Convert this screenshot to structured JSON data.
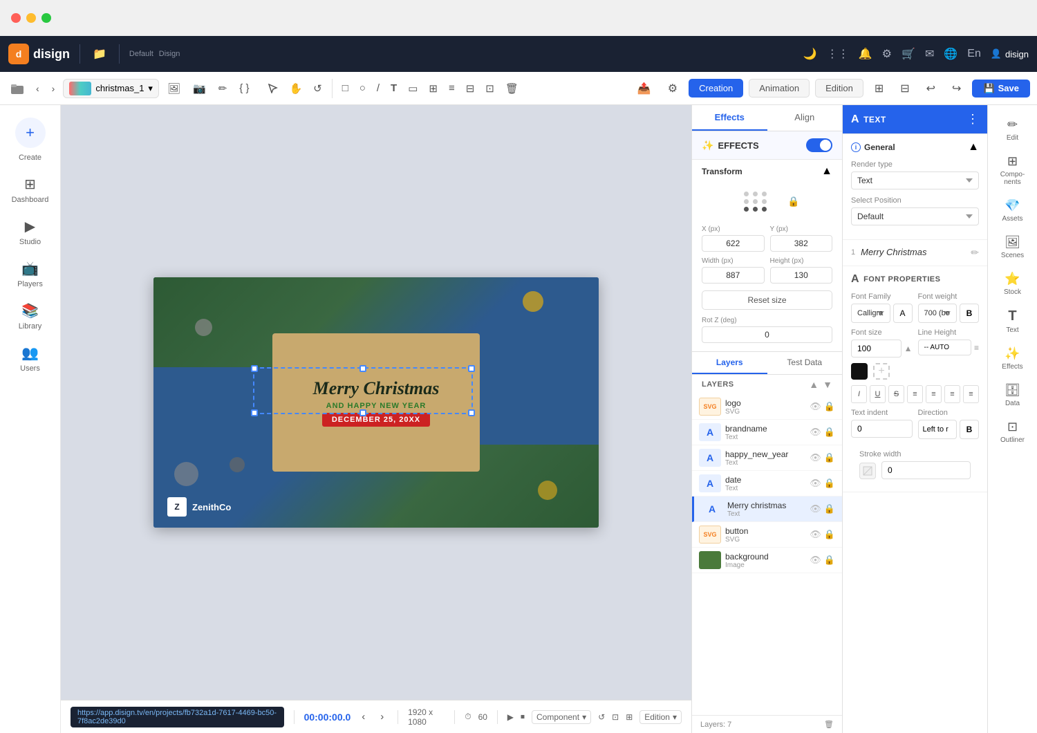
{
  "window": {
    "mac_close": "close",
    "mac_min": "minimize",
    "mac_max": "maximize"
  },
  "topnav": {
    "logo_text": "disign",
    "logo_letter": "d",
    "folder_icon": "📁",
    "breadcrumb_sep": ">",
    "project_name": "Default",
    "project_sub": "Disign",
    "right_icons": [
      "🌙",
      "⋮⋮⋮",
      "✉",
      "🔧",
      "🛒",
      "✉",
      "🌐"
    ],
    "language": "En",
    "user_icon": "👤",
    "username": "disign"
  },
  "toolbar": {
    "folder_btn": "📁",
    "nav_back": "<",
    "nav_fwd": ">",
    "filename": "christmas_1",
    "file_dropdown": "▾",
    "tool_icons": [
      "□",
      "○",
      "/",
      "T",
      "▭",
      "⊞",
      "≡",
      "⊟",
      "⊡",
      "🗑"
    ],
    "save_btn": "Save",
    "save_icon": "💾",
    "mode_creation": "Creation",
    "mode_animation": "Animation",
    "mode_edition": "Edition",
    "undo": "↩",
    "redo": "↪",
    "share_icon": "📤",
    "settings_icon": "⚙"
  },
  "left_sidebar": {
    "create_icon": "+",
    "items": [
      {
        "id": "create",
        "icon": "+",
        "label": "Create"
      },
      {
        "id": "dashboard",
        "icon": "⊞",
        "label": "Dashboard"
      },
      {
        "id": "studio",
        "icon": "▶",
        "label": "Studio"
      },
      {
        "id": "players",
        "icon": "📺",
        "label": "Players"
      },
      {
        "id": "library",
        "icon": "📚",
        "label": "Library"
      },
      {
        "id": "users",
        "icon": "👥",
        "label": "Users"
      }
    ]
  },
  "canvas": {
    "card_title": "Merry Christmas",
    "card_subtitle": "AND HAPPY NEW YEAR",
    "card_date": "DECEMBER 25, 20XX",
    "brand_letter": "Z",
    "brand_name": "ZenithCo"
  },
  "bottom_bar": {
    "url": "https://app.disign.tv/en/projects/fb732a1d-7617-4469-bc50-7f8ac2de39d0",
    "timecode": "00:00:00.0",
    "prev_icon": "<",
    "next_icon": ">",
    "dimensions": "1920 x 1080",
    "duration": "60",
    "component": "Component",
    "edition": "Edition",
    "layers_count": "Layers: 7"
  },
  "effects_panel": {
    "tab_effects": "Effects",
    "tab_align": "Align",
    "section_title": "EFFECTS",
    "toggle_on": true,
    "transform_label": "Transform",
    "x_label": "X (px)",
    "x_val": "622",
    "y_label": "Y (px)",
    "y_val": "382",
    "width_label": "Width (px)",
    "width_val": "887",
    "height_label": "Height (px)",
    "height_val": "130",
    "reset_btn": "Reset size",
    "rot_label": "Rot Z (deg)",
    "rot_val": "0"
  },
  "layers_panel": {
    "tab_layers": "Layers",
    "tab_testdata": "Test Data",
    "header": "LAYERS",
    "items": [
      {
        "id": "logo",
        "thumb_type": "svg",
        "thumb_text": "SVG",
        "name": "logo",
        "type": "SVG"
      },
      {
        "id": "brandname",
        "thumb_type": "text",
        "thumb_text": "A",
        "name": "brandname",
        "type": "Text"
      },
      {
        "id": "happy_new_year",
        "thumb_type": "text",
        "thumb_text": "A",
        "name": "happy_new_year",
        "type": "Text"
      },
      {
        "id": "date",
        "thumb_type": "text",
        "thumb_text": "A",
        "name": "date",
        "type": "Text"
      },
      {
        "id": "merry_christmas",
        "thumb_type": "text",
        "thumb_text": "A",
        "name": "Merry christmas",
        "type": "Text",
        "active": true
      },
      {
        "id": "button",
        "thumb_type": "svg",
        "thumb_text": "SVG",
        "name": "button",
        "type": "SVG"
      },
      {
        "id": "background",
        "thumb_type": "img",
        "thumb_text": "",
        "name": "background",
        "type": "Image"
      }
    ]
  },
  "props_panel": {
    "title": "TEXT",
    "title_icon": "A",
    "section_general": "General",
    "render_type_label": "Render type",
    "render_type_val": "Text",
    "select_pos_label": "Select Position",
    "select_pos_val": "Default",
    "text_line_num": "1",
    "text_line_val": "Merry Christmas",
    "font_section_title": "FONT PROPERTIES",
    "font_family_label": "Font Family",
    "font_family_val": "Calligra",
    "font_weight_label": "Font weight",
    "font_weight_val": "700 (bo",
    "font_size_label": "Font size",
    "font_size_val": "100",
    "line_height_label": "Line Height",
    "line_height_val": "-- AUTO",
    "text_indent_label": "Text indent",
    "text_indent_val": "0",
    "direction_label": "Direction",
    "direction_val": "Left to r",
    "stroke_label": "Stroke width",
    "stroke_val": "0",
    "format_btns": [
      "I",
      "U",
      "S",
      "≡",
      "≡",
      "≡",
      "≡"
    ]
  },
  "far_right": {
    "items": [
      {
        "id": "edit",
        "icon": "✏",
        "label": "Edit"
      },
      {
        "id": "components",
        "icon": "⊞",
        "label": "Components"
      },
      {
        "id": "assets",
        "icon": "💎",
        "label": "Assets"
      },
      {
        "id": "scenes",
        "icon": "🖼",
        "label": "Scenes"
      },
      {
        "id": "stock",
        "icon": "⭐",
        "label": "Stock"
      },
      {
        "id": "text",
        "icon": "T",
        "label": "Text"
      },
      {
        "id": "effects",
        "icon": "✨",
        "label": "Effects"
      },
      {
        "id": "data",
        "icon": "🗄",
        "label": "Data"
      },
      {
        "id": "outliner",
        "icon": "⊡",
        "label": "Outliner"
      }
    ]
  }
}
